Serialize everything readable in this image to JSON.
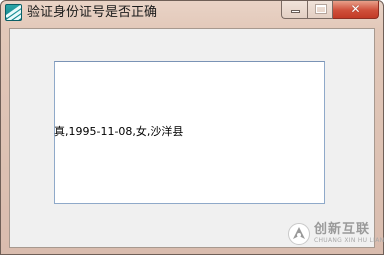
{
  "window": {
    "title": "验证身份证号是否正确",
    "icon": "app-icon",
    "controls": {
      "minimize_icon": "minimize-icon",
      "maximize_icon": "maximize-icon",
      "close_glyph": "✕"
    }
  },
  "textbox": {
    "content": "真,1995-11-08,女,沙洋县"
  },
  "watermark": {
    "name": "创新互联",
    "subtitle": "CHUANG XIN HU LIAN"
  },
  "colors": {
    "titlebar": "#e2c8b9",
    "client_bg": "#f0f0f0",
    "textbox_border": "#8fa9c9",
    "close_button": "#cf4f3a"
  }
}
